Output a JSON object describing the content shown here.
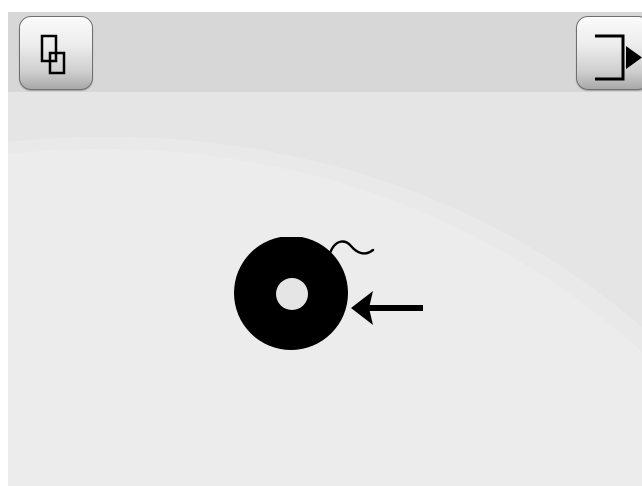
{
  "screen": {
    "colors": {
      "display_background": "#e5e5e6",
      "topbar_background": "#d8d7d8",
      "icon": "#000000"
    }
  },
  "toolbar": {
    "left_button": {
      "icon": "duplicate-icon"
    },
    "right_button": {
      "icon": "exit-icon"
    }
  },
  "main": {
    "illustration": {
      "icons": [
        "filament-spool-icon",
        "insert-arrow-icon"
      ]
    }
  }
}
